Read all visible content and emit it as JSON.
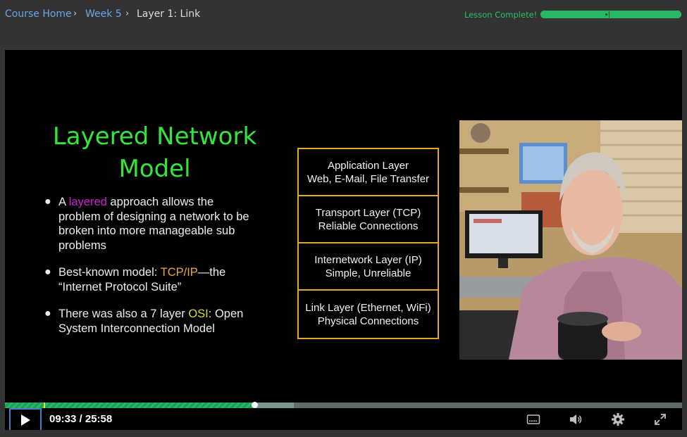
{
  "breadcrumb": {
    "items": [
      "Course Home",
      "Week 5",
      "Layer 1: Link"
    ]
  },
  "lesson": {
    "status": "Lesson Complete!",
    "progress_fraction": 1.0
  },
  "slide": {
    "title_line1": "Layered Network",
    "title_line2": "Model",
    "bullets": [
      {
        "pre": "A ",
        "hl": "layered",
        "post": " approach allows the problem of designing a network to be broken into more manageable sub problems"
      },
      {
        "pre": "Best-known model: ",
        "hl": "TCP/IP",
        "post": "—the “Internet Protocol Suite”"
      },
      {
        "pre": "There was also a 7 layer ",
        "hl": "OSI",
        "post": ":  Open System Interconnection Model"
      }
    ],
    "layers": [
      {
        "name": "Application Layer",
        "desc": "Web, E-Mail, File Transfer"
      },
      {
        "name": "Transport Layer (TCP)",
        "desc": "Reliable Connections"
      },
      {
        "name": "Internetwork Layer (IP)",
        "desc": "Simple, Unreliable"
      },
      {
        "name": "Link Layer (Ethernet, WiFi)",
        "desc": "Physical Connections"
      }
    ]
  },
  "player": {
    "current_time": "09:33",
    "duration": "25:58",
    "time_display": "09:33 / 25:58",
    "played_fraction": 0.368,
    "buffered_fraction": 0.427,
    "marker_fraction": 0.057
  },
  "icons": {
    "play": "play-icon",
    "captions": "captions-icon",
    "volume": "volume-icon",
    "settings": "gear-icon",
    "fullscreen": "fullscreen-icon"
  },
  "colors": {
    "accent_green": "#28b565",
    "link_blue": "#6aa6e8",
    "title_green": "#33e63a",
    "box_orange": "#e3a72a",
    "highlight_pink": "#d21fd4",
    "highlight_orange": "#e9a93a",
    "highlight_yellow": "#e0d83a"
  }
}
